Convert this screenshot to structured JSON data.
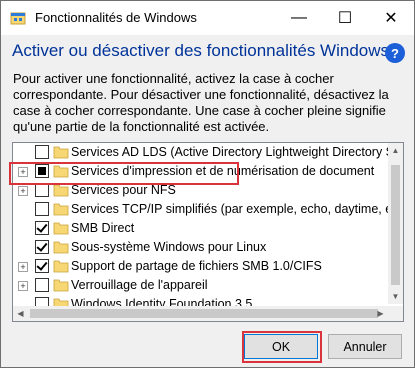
{
  "window": {
    "title": "Fonctionnalités de Windows",
    "minimize": "—",
    "maximize": "☐",
    "close": "✕"
  },
  "header": {
    "heading": "Activer ou désactiver des fonctionnalités Windows",
    "help": "?"
  },
  "description": "Pour activer une fonctionnalité, activez la case à cocher correspondante. Pour désactiver une fonctionnalité, désactivez la case à cocher correspondante. Une case à cocher pleine signifie qu'une partie de la fonctionnalité est activée.",
  "features": [
    {
      "label": "Services AD LDS (Active Directory Lightweight Directory Serv",
      "state": "unchecked",
      "expandable": false
    },
    {
      "label": "Services d'impression et de numérisation de document",
      "state": "partial",
      "expandable": true
    },
    {
      "label": "Services pour NFS",
      "state": "unchecked",
      "expandable": true
    },
    {
      "label": "Services TCP/IP simplifiés (par exemple, echo, daytime, etc.)",
      "state": "unchecked",
      "expandable": false
    },
    {
      "label": "SMB Direct",
      "state": "checked",
      "expandable": false
    },
    {
      "label": "Sous-système Windows pour Linux",
      "state": "checked",
      "expandable": false
    },
    {
      "label": "Support de partage de fichiers SMB 1.0/CIFS",
      "state": "checked",
      "expandable": true
    },
    {
      "label": "Verrouillage de l'appareil",
      "state": "unchecked",
      "expandable": true
    },
    {
      "label": "Windows Identity Foundation 3.5",
      "state": "unchecked",
      "expandable": false
    }
  ],
  "buttons": {
    "ok": "OK",
    "cancel": "Annuler"
  },
  "colors": {
    "heading": "#003399",
    "highlight": "#d9333b",
    "folder": "#f7d774",
    "help": "#1c5fd8"
  }
}
